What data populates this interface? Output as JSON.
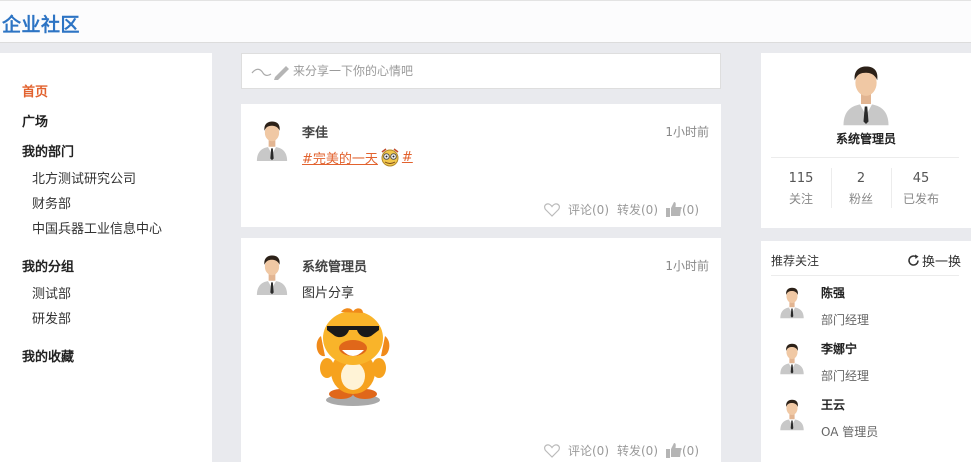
{
  "app": {
    "title": "企业社区"
  },
  "nav": {
    "home": "首页",
    "square": "广场",
    "my_departments": "我的部门",
    "departments": [
      "北方测试研究公司",
      "财务部",
      "中国兵器工业信息中心"
    ],
    "my_groups": "我的分组",
    "groups": [
      "测试部",
      "研发部"
    ],
    "favorites": "我的收藏"
  },
  "composer": {
    "placeholder": "来分享一下你的心情吧"
  },
  "posts": [
    {
      "author": "李佳",
      "time": "1小时前",
      "topic": "#完美的一天",
      "topic_end": "#",
      "comment": "评论(0)",
      "forward": "转发(0)",
      "like": "(0)"
    },
    {
      "author": "系统管理员",
      "time": "1小时前",
      "text": "图片分享",
      "comment": "评论(0)",
      "forward": "转发(0)",
      "like": "(0)"
    }
  ],
  "profile": {
    "name": "系统管理员",
    "following": {
      "value": "115",
      "label": "关注"
    },
    "followers": {
      "value": "2",
      "label": "粉丝"
    },
    "published": {
      "value": "45",
      "label": "已发布"
    }
  },
  "recommend": {
    "title": "推荐关注",
    "refresh": "换一换",
    "users": [
      {
        "name": "陈强",
        "role": "部门经理"
      },
      {
        "name": "李娜宁",
        "role": "部门经理"
      },
      {
        "name": "王云",
        "role": "OA 管理员"
      }
    ]
  },
  "colors": {
    "brand": "#2d74c4",
    "accent": "#e2622e",
    "background": "#e9eaee"
  }
}
